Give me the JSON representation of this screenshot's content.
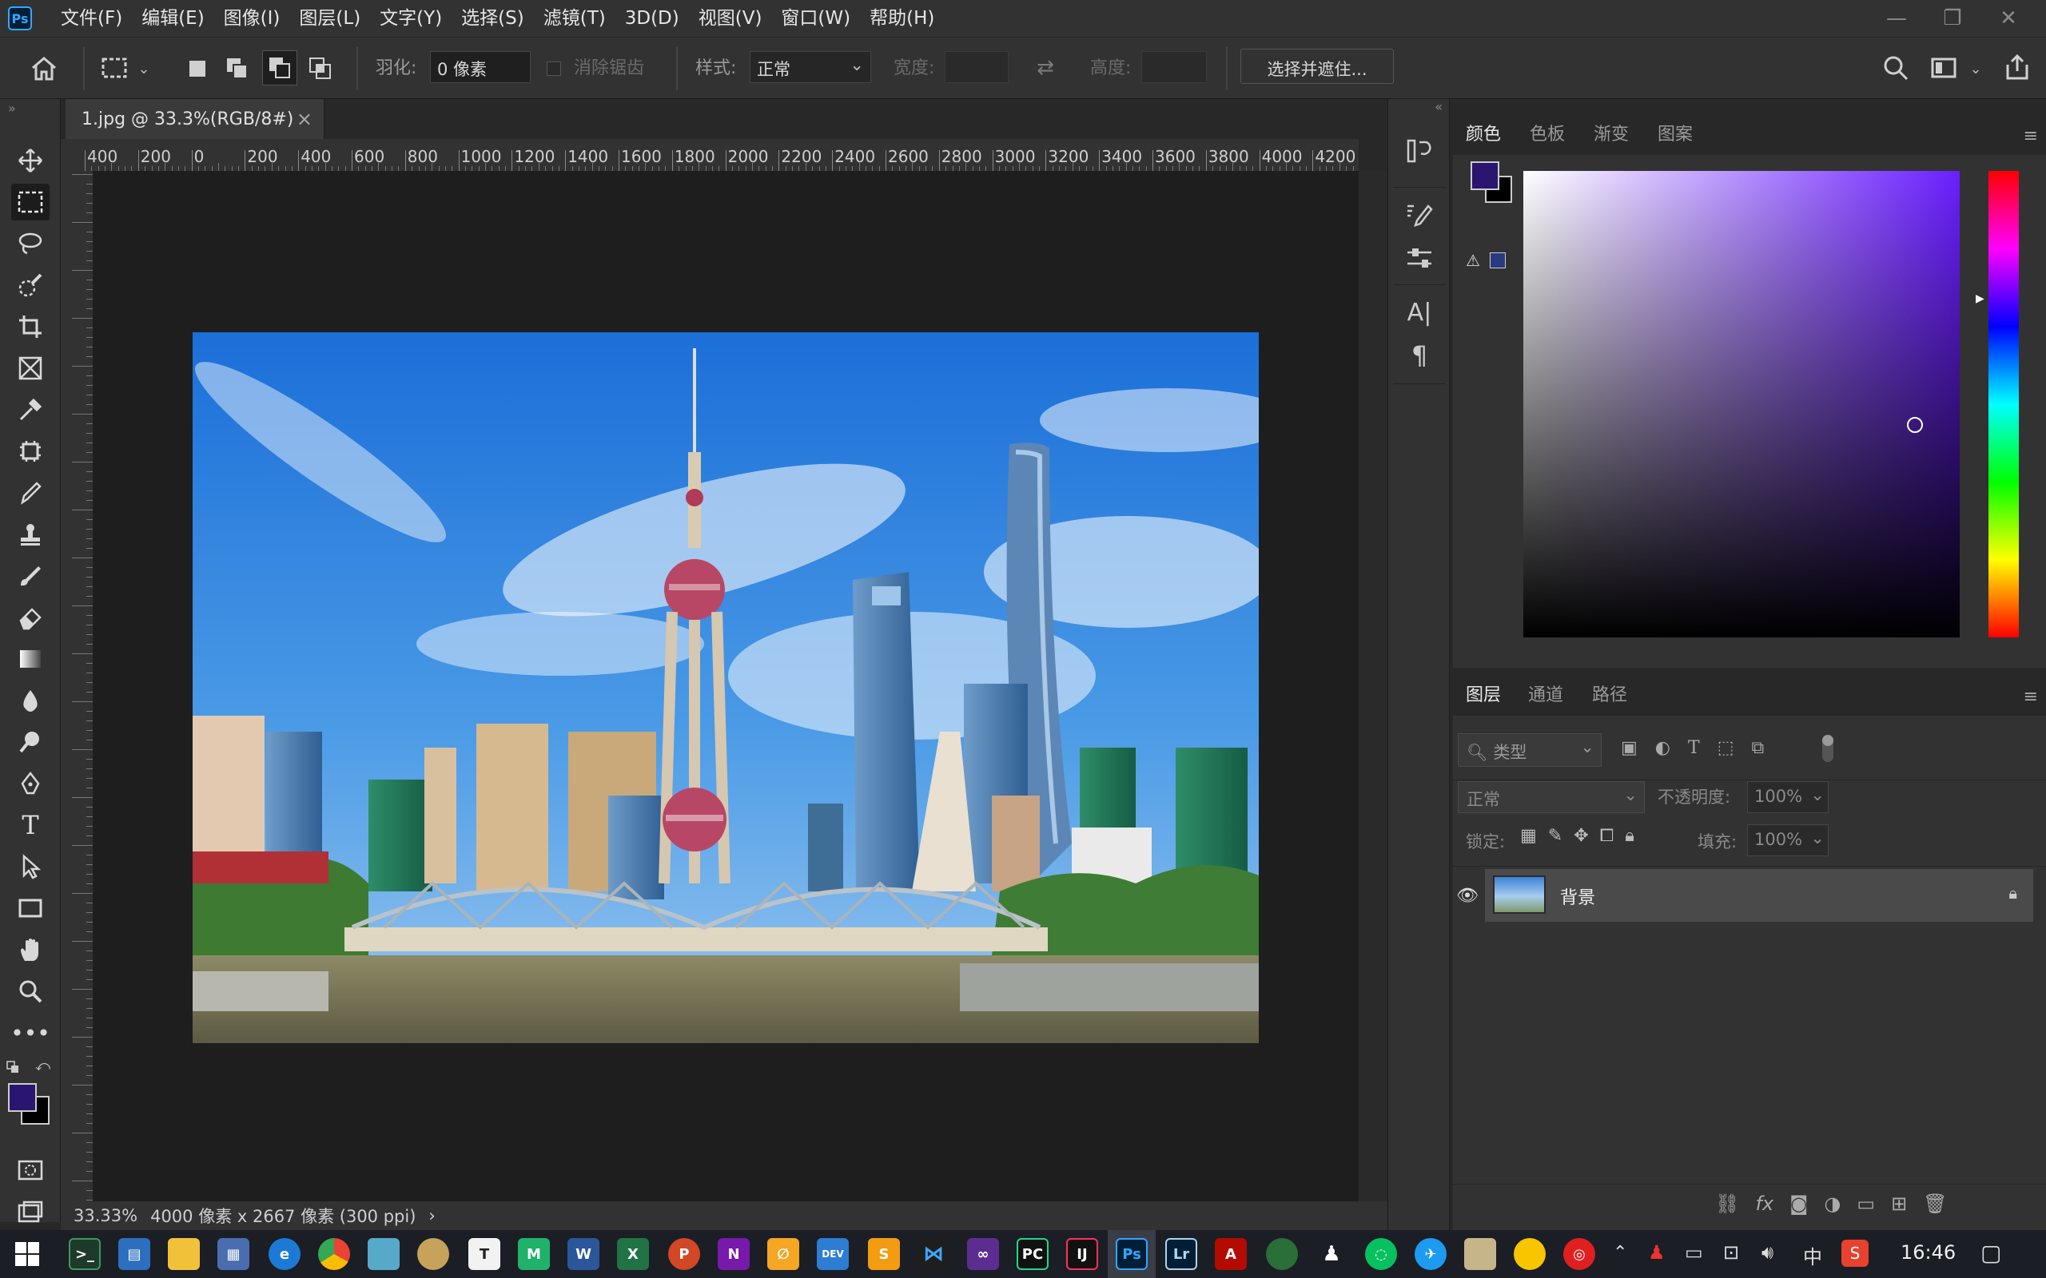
{
  "menubar": {
    "logo": "Ps",
    "items": [
      "文件(F)",
      "编辑(E)",
      "图像(I)",
      "图层(L)",
      "文字(Y)",
      "选择(S)",
      "滤镜(T)",
      "3D(D)",
      "视图(V)",
      "窗口(W)",
      "帮助(H)"
    ]
  },
  "options": {
    "feather_label": "羽化:",
    "feather_value": "0 像素",
    "antialias_label": "消除锯齿",
    "style_label": "样式:",
    "style_value": "正常",
    "width_label": "宽度:",
    "height_label": "高度:",
    "select_mask_button": "选择并遮住..."
  },
  "document": {
    "tab_title": "1.jpg @ 33.3%(RGB/8#)",
    "close": "×",
    "ruler_h": [
      "400",
      "200",
      "0",
      "200",
      "400",
      "600",
      "800",
      "1000",
      "1200",
      "1400",
      "1600",
      "1800",
      "2000",
      "2200",
      "2400",
      "2600",
      "2800",
      "3000",
      "3200",
      "3400",
      "3600",
      "3800",
      "4000",
      "4200"
    ],
    "status_zoom": "33.33%",
    "status_info": "4000 像素 x 2667 像素 (300 ppi)",
    "status_arrow": "›"
  },
  "color_panel": {
    "tabs": [
      "颜色",
      "色板",
      "渐变",
      "图案"
    ],
    "foreground": "#2a1570",
    "background": "#000000"
  },
  "layers_panel": {
    "tabs": [
      "图层",
      "通道",
      "路径"
    ],
    "filter_placeholder": "类型",
    "blend_mode": "正常",
    "opacity_label": "不透明度:",
    "opacity_value": "100%",
    "lock_label": "锁定:",
    "fill_label": "填充:",
    "fill_value": "100%",
    "layers": [
      {
        "name": "背景",
        "visible": true,
        "locked": true
      }
    ]
  },
  "taskbar": {
    "time": "16:46",
    "ime": "中"
  }
}
